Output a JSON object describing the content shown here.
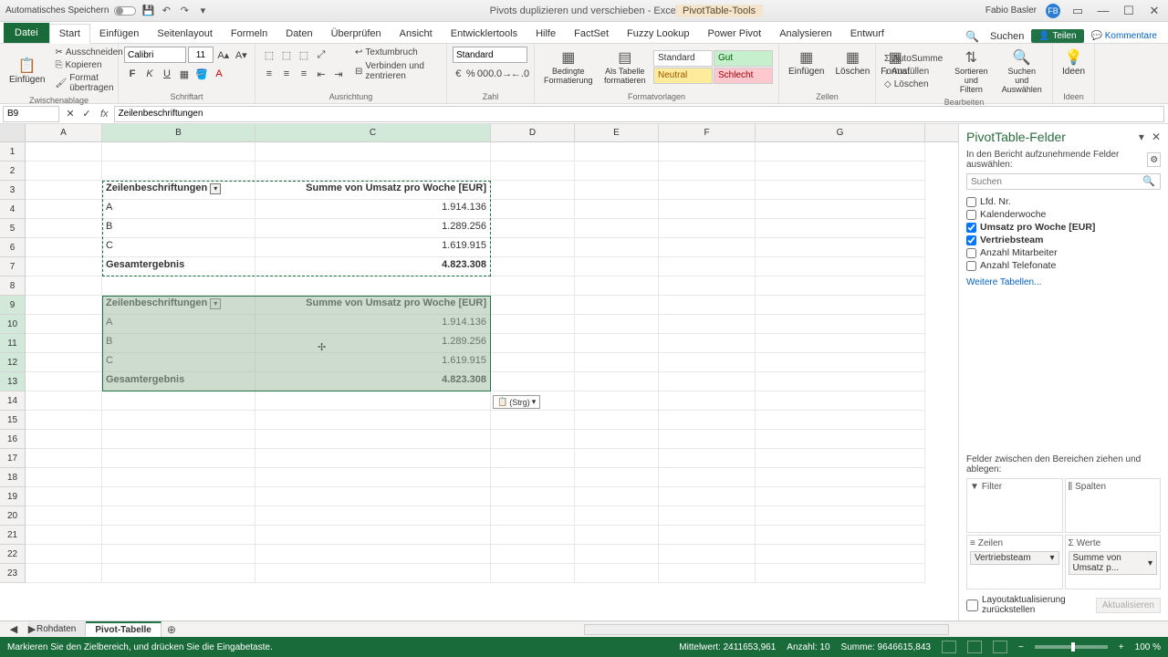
{
  "titlebar": {
    "autosave": "Automatisches Speichern",
    "doc_title": "Pivots duplizieren und verschieben  -  Excel",
    "pivot_tools": "PivotTable-Tools",
    "user_name": "Fabio Basler",
    "user_initials": "FB"
  },
  "ribbon_tabs": {
    "file": "Datei",
    "tabs": [
      "Start",
      "Einfügen",
      "Seitenlayout",
      "Formeln",
      "Daten",
      "Überprüfen",
      "Ansicht",
      "Entwicklertools",
      "Hilfe",
      "FactSet",
      "Fuzzy Lookup",
      "Power Pivot",
      "Analysieren",
      "Entwurf"
    ],
    "search": "Suchen",
    "share": "Teilen",
    "comments": "Kommentare"
  },
  "ribbon": {
    "clipboard": {
      "paste": "Einfügen",
      "cut": "Ausschneiden",
      "copy": "Kopieren",
      "formatpainter": "Format übertragen",
      "label": "Zwischenablage"
    },
    "font": {
      "name": "Calibri",
      "size": "11",
      "label": "Schriftart"
    },
    "alignment": {
      "wrap": "Textumbruch",
      "merge": "Verbinden und zentrieren",
      "label": "Ausrichtung"
    },
    "number": {
      "format": "Standard",
      "label": "Zahl"
    },
    "styles": {
      "cond": "Bedingte Formatierung",
      "astable": "Als Tabelle formatieren",
      "s1": "Standard",
      "s2": "Gut",
      "s3": "Neutral",
      "s4": "Schlecht",
      "label": "Formatvorlagen"
    },
    "cells": {
      "insert": "Einfügen",
      "delete": "Löschen",
      "format": "Format",
      "label": "Zellen"
    },
    "editing": {
      "autosum": "AutoSumme",
      "fill": "Ausfüllen",
      "clear": "Löschen",
      "sort": "Sortieren und Filtern",
      "find": "Suchen und Auswählen",
      "label": "Bearbeiten"
    },
    "ideas": {
      "label": "Ideen",
      "btn": "Ideen"
    }
  },
  "fbar": {
    "name": "B9",
    "formula": "Zeilenbeschriftungen"
  },
  "grid": {
    "col_widths": {
      "A": 84,
      "B": 168,
      "C": 258,
      "D": 92,
      "E": 92,
      "F": 106,
      "G": 186
    },
    "columns": [
      "A",
      "B",
      "C",
      "D",
      "E",
      "F",
      "G"
    ],
    "rows": 23,
    "pivot1": {
      "top_row": 3,
      "header_b": "Zeilenbeschriftungen",
      "header_c": "Summe von Umsatz pro Woche [EUR]",
      "data": [
        {
          "label": "A",
          "val": "1.914.136"
        },
        {
          "label": "B",
          "val": "1.289.256"
        },
        {
          "label": "C",
          "val": "1.619.915"
        }
      ],
      "total_label": "Gesamtergebnis",
      "total_val": "4.823.308"
    },
    "pivot2": {
      "top_row": 9,
      "header_b": "Zeilenbeschriftungen",
      "header_c": "Summe von Umsatz pro Woche [EUR]",
      "data": [
        {
          "label": "A",
          "val": "1.914.136"
        },
        {
          "label": "B",
          "val": "1.289.256"
        },
        {
          "label": "C",
          "val": "1.619.915"
        }
      ],
      "total_label": "Gesamtergebnis",
      "total_val": "4.823.308"
    },
    "paste_tag": "(Strg)"
  },
  "fieldlist": {
    "title": "PivotTable-Felder",
    "sub": "In den Bericht aufzunehmende Felder auswählen:",
    "search_ph": "Suchen",
    "fields": [
      {
        "name": "Lfd. Nr.",
        "checked": false
      },
      {
        "name": "Kalenderwoche",
        "checked": false
      },
      {
        "name": "Umsatz pro Woche [EUR]",
        "checked": true
      },
      {
        "name": "Vertriebsteam",
        "checked": true
      },
      {
        "name": "Anzahl Mitarbeiter",
        "checked": false
      },
      {
        "name": "Anzahl Telefonate",
        "checked": false
      }
    ],
    "more": "Weitere Tabellen...",
    "drag": "Felder zwischen den Bereichen ziehen und ablegen:",
    "areas": {
      "filter": "Filter",
      "cols": "Spalten",
      "rows": "Zeilen",
      "vals": "Werte"
    },
    "row_pill": "Vertriebsteam",
    "val_pill": "Summe von Umsatz p...",
    "defer": "Layoutaktualisierung zurückstellen",
    "update": "Aktualisieren"
  },
  "sheets": {
    "tabs": [
      "Rohdaten",
      "Pivot-Tabelle"
    ],
    "active": 1
  },
  "status": {
    "mode": "Markieren Sie den Zielbereich, und drücken Sie die Eingabetaste.",
    "avg": "Mittelwert: 2411653,961",
    "count": "Anzahl: 10",
    "sum": "Summe: 9646615,843",
    "zoom": "100 %"
  }
}
